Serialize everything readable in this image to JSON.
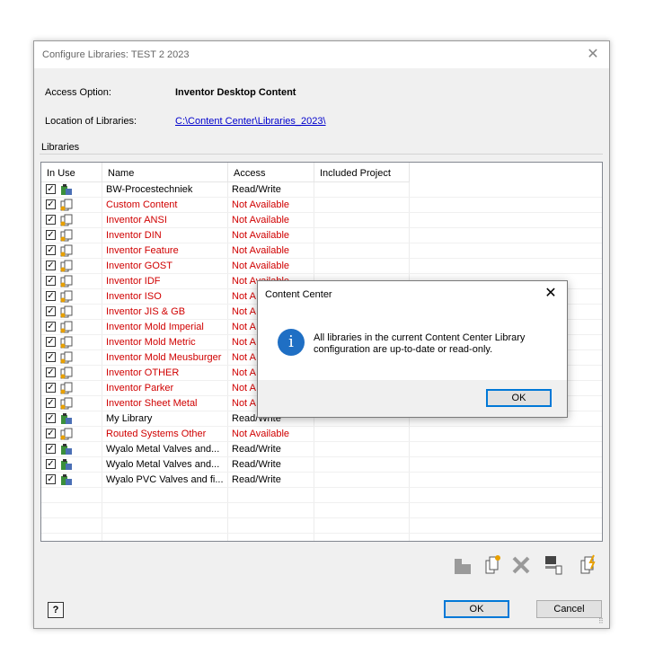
{
  "dialog": {
    "title": "Configure Libraries: TEST 2 2023",
    "close_icon": "close-icon",
    "access_option_label": "Access Option:",
    "access_option_value": "Inventor Desktop Content",
    "location_label": "Location of Libraries:",
    "location_value": "C:\\Content Center\\Libraries_2023\\",
    "libraries_group_label": "Libraries",
    "columns": [
      "In Use",
      "Name",
      "Access",
      "Included Project"
    ],
    "libraries": [
      {
        "name": "BW-Procestechniek",
        "access": "Read/Write",
        "icon": "library-readwrite-icon",
        "available": true
      },
      {
        "name": "Custom Content",
        "access": "Not Available",
        "icon": "library-unavailable-icon",
        "available": false
      },
      {
        "name": "Inventor ANSI",
        "access": "Not Available",
        "icon": "library-unavailable-icon",
        "available": false
      },
      {
        "name": "Inventor DIN",
        "access": "Not Available",
        "icon": "library-unavailable-icon",
        "available": false
      },
      {
        "name": "Inventor Feature",
        "access": "Not Available",
        "icon": "library-unavailable-icon",
        "available": false
      },
      {
        "name": "Inventor GOST",
        "access": "Not Available",
        "icon": "library-unavailable-icon",
        "available": false
      },
      {
        "name": "Inventor IDF",
        "access": "Not Available",
        "icon": "library-unavailable-icon",
        "available": false
      },
      {
        "name": "Inventor ISO",
        "access": "Not A",
        "icon": "library-unavailable-icon",
        "available": false
      },
      {
        "name": "Inventor JIS & GB",
        "access": "Not A",
        "icon": "library-unavailable-icon",
        "available": false
      },
      {
        "name": "Inventor Mold Imperial",
        "access": "Not A",
        "icon": "library-unavailable-icon",
        "available": false
      },
      {
        "name": "Inventor Mold Metric",
        "access": "Not A",
        "icon": "library-unavailable-icon",
        "available": false
      },
      {
        "name": "Inventor Mold Meusburger",
        "access": "Not A",
        "icon": "library-unavailable-icon",
        "available": false
      },
      {
        "name": "Inventor OTHER",
        "access": "Not A",
        "icon": "library-unavailable-icon",
        "available": false
      },
      {
        "name": "Inventor Parker",
        "access": "Not A",
        "icon": "library-unavailable-icon",
        "available": false
      },
      {
        "name": "Inventor Sheet Metal",
        "access": "Not A",
        "icon": "library-unavailable-icon",
        "available": false
      },
      {
        "name": "My Library",
        "access": "Read/Write",
        "icon": "library-readwrite-icon",
        "available": true
      },
      {
        "name": "Routed Systems Other",
        "access": "Not Available",
        "icon": "library-unavailable-icon",
        "available": false
      },
      {
        "name": "Wyalo Metal Valves and...",
        "access": "Read/Write",
        "icon": "library-readwrite-icon",
        "available": true
      },
      {
        "name": "Wyalo Metal Valves and...",
        "access": "Read/Write",
        "icon": "library-readwrite-icon",
        "available": true
      },
      {
        "name": "Wyalo PVC Valves and fi...",
        "access": "Read/Write",
        "icon": "library-readwrite-icon",
        "available": true
      }
    ],
    "toolbar_icons": [
      "upgrade-library-icon",
      "create-library-icon",
      "remove-library-icon",
      "library-properties-icon",
      "migrate-library-icon"
    ],
    "ok_label": "OK",
    "cancel_label": "Cancel",
    "help_label": "?"
  },
  "message_box": {
    "title": "Content Center",
    "text": "All libraries in the current Content Center Library configuration are up-to-date or read-only.",
    "icon": "info-icon",
    "ok_label": "OK"
  },
  "colors": {
    "unavailable_text": "#d00000",
    "info_icon": "#1f6fc4",
    "default_button_border": "#0078d7"
  }
}
